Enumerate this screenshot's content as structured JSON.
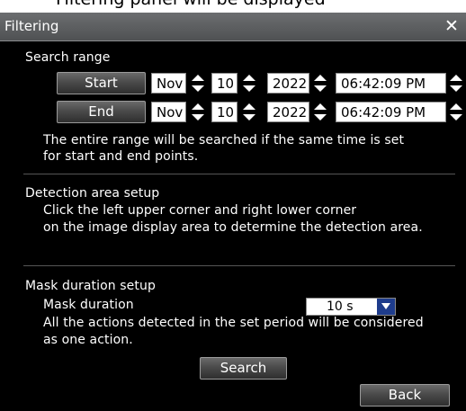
{
  "page_caption_partial": "Filtering panel will be displayed",
  "dialog": {
    "title": "Filtering",
    "close_glyph": "✕",
    "close_icon": "close-icon",
    "search_range": {
      "heading": "Search range",
      "start": {
        "label": "Start",
        "month": "Nov",
        "day": "10",
        "year": "2022",
        "time": "06:42:09 PM"
      },
      "end": {
        "label": "End",
        "month": "Nov",
        "day": "10",
        "year": "2022",
        "time": "06:42:09 PM"
      },
      "note_line1": "The entire range will be searched if the same time is set",
      "note_line2": "for start and end points."
    },
    "detection_area": {
      "heading": "Detection area setup",
      "line1": "Click the left upper corner and right lower corner",
      "line2": "on the image display area to determine the detection area."
    },
    "mask_duration": {
      "heading": "Mask duration setup",
      "label": "Mask duration",
      "value": "10 s",
      "dropdown_icon": "dropdown-arrow-icon",
      "note_line1": "All the actions detected in the set period will be considered",
      "note_line2": "as one action."
    },
    "search_button": "Search",
    "back_button": "Back"
  },
  "colors": {
    "dialog_bg": "#000000",
    "title_bar": "#5f6163",
    "dropdown_arrow_bg": "#1e3c8c",
    "field_bg": "#ffffff"
  }
}
